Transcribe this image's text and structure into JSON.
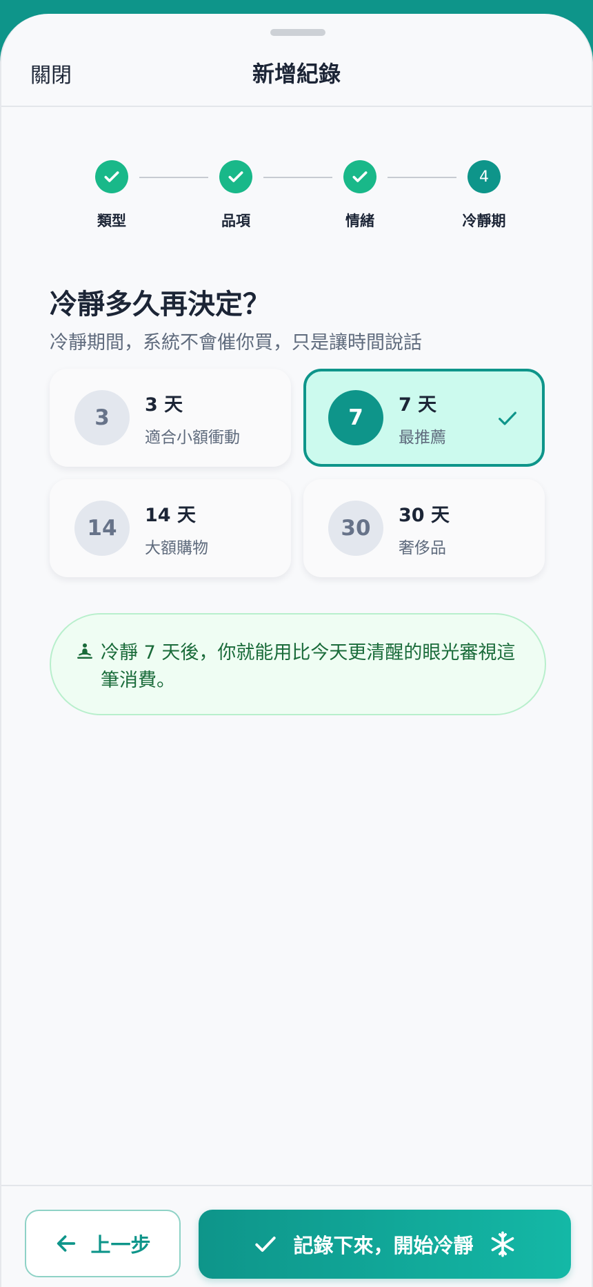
{
  "header": {
    "close_label": "關閉",
    "title": "新增紀錄"
  },
  "stepper": {
    "steps": [
      {
        "label": "類型",
        "state": "done"
      },
      {
        "label": "品項",
        "state": "done"
      },
      {
        "label": "情緒",
        "state": "done"
      },
      {
        "label": "冷靜期",
        "state": "current",
        "number": "4"
      }
    ]
  },
  "question": {
    "title": "冷靜多久再決定？",
    "subtitle": "冷靜期間，系統不會催你買，只是讓時間說話"
  },
  "options": [
    {
      "badge": "3",
      "name": "3 天",
      "desc": "適合小額衝動",
      "selected": false
    },
    {
      "badge": "7",
      "name": "7 天",
      "desc": "最推薦",
      "selected": true
    },
    {
      "badge": "14",
      "name": "14 天",
      "desc": "大額購物",
      "selected": false
    },
    {
      "badge": "30",
      "name": "30 天",
      "desc": "奢侈品",
      "selected": false
    }
  ],
  "tip": {
    "icon": "meditation-icon",
    "text": "冷靜 7 天後，你就能用比今天更清醒的眼光審視這筆消費。"
  },
  "footer": {
    "back_label": "上一步",
    "submit_label": "記錄下來，開始冷靜"
  },
  "colors": {
    "accent": "#0e958a",
    "done": "#19b889",
    "selected_bg": "#ccfaee",
    "tip_bg": "#effdf3",
    "tip_text": "#1a6b3a"
  }
}
